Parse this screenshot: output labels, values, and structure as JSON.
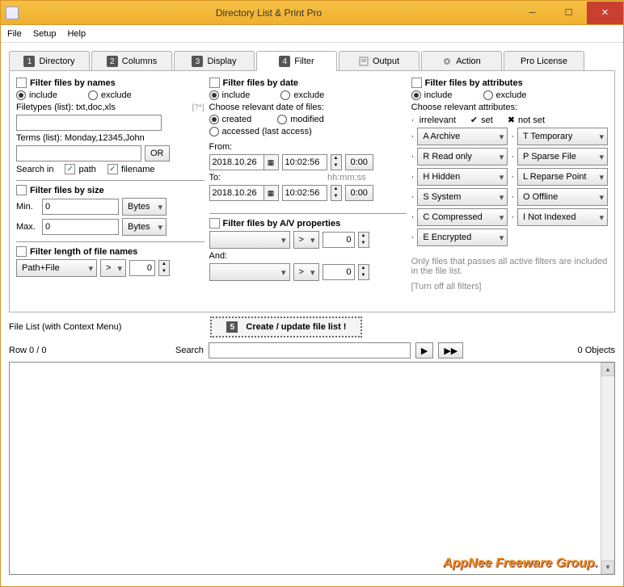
{
  "window": {
    "title": "Directory List & Print Pro"
  },
  "menu": {
    "file": "File",
    "setup": "Setup",
    "help": "Help"
  },
  "tabs": {
    "directory": "Directory",
    "columns": "Columns",
    "display": "Display",
    "filter": "Filter",
    "output": "Output",
    "action": "Action",
    "pro": "Pro License"
  },
  "names": {
    "title": "Filter files by names",
    "include": "include",
    "exclude": "exclude",
    "filetypes_label": "Filetypes (list): txt,doc,xls",
    "filetypes_hint": "[?*]",
    "filetypes_value": "",
    "terms_label": "Terms (list): Monday,12345,John",
    "terms_value": "",
    "or": "OR",
    "searchin": "Search in",
    "path": "path",
    "filename": "filename"
  },
  "size": {
    "title": "Filter files by size",
    "min_label": "Min.",
    "min_value": "0",
    "min_unit": "Bytes",
    "max_label": "Max.",
    "max_value": "0",
    "max_unit": "Bytes"
  },
  "length": {
    "title": "Filter length of file names",
    "sel": "Path+File",
    "op": ">",
    "val": "0"
  },
  "date": {
    "title": "Filter files by date",
    "include": "include",
    "exclude": "exclude",
    "choose": "Choose relevant date of files:",
    "created": "created",
    "modified": "modified",
    "accessed": "accessed (last access)",
    "from": "From:",
    "from_date": "2018.10.26",
    "from_time": "10:02:56",
    "zero": "0:00",
    "to": "To:",
    "hhmmss": "hh:mm:ss",
    "to_date": "2018.10.26",
    "to_time": "10:02:56"
  },
  "av": {
    "title": "Filter files by A/V properties",
    "op": ">",
    "val": "0",
    "and": "And:",
    "op2": ">",
    "val2": "0"
  },
  "attr": {
    "title": "Filter files by attributes",
    "include": "include",
    "exclude": "exclude",
    "choose": "Choose relevant attributes:",
    "irrelevant": "irrelevant",
    "set": "set",
    "notset": "not set",
    "a": "A  Archive",
    "t": "T  Temporary",
    "r": "R  Read only",
    "p": "P  Sparse File",
    "h": "H  Hidden",
    "l": "L  Reparse Point",
    "s": "S  System",
    "o": "O  Offline",
    "c": "C  Compressed",
    "i": "I  Not Indexed",
    "e": "E  Encrypted",
    "note": "Only files that passes all active filters are included in the file list.",
    "turnoff": "[Turn off all filters]"
  },
  "mid": {
    "filelist": "File List (with Context Menu)",
    "create": "Create / update file list !"
  },
  "search": {
    "row": "Row 0 / 0",
    "label": "Search",
    "value": "",
    "objects": "0 Objects"
  },
  "watermark": "AppNee Freeware Group."
}
